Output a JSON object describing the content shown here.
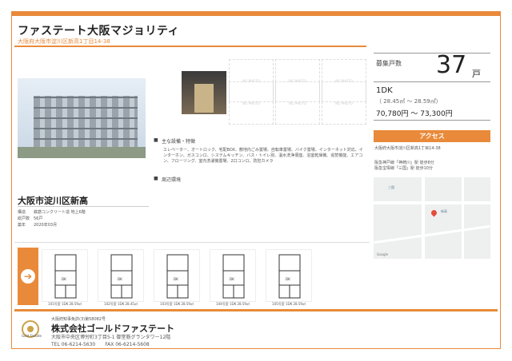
{
  "header": {
    "title": "ファステート大阪マジョリティ",
    "address": "大阪府大阪市淀川区新高1丁目14-38"
  },
  "photos": {
    "placeholder_label": "NO PHOTO"
  },
  "equipment": {
    "heading": "主な設備・特徴",
    "text": "エレベーター、オートロック、宅配BOX、敷地内ごみ置場、自転車置場、バイク置場、インターネット対応、インターホン、ガスコンロ、システムキッチン、バス・トイレ別、温水洗浄便座、浴室乾燥機、追焚機能、エアコン、フローリング、室内洗濯機置場、2口コンロ、防犯カメラ",
    "env_heading": "周辺環境"
  },
  "property": {
    "area_name": "大阪市淀川区新高",
    "rows": [
      {
        "k": "構造",
        "v": "鉄筋コンクリート造 地上6階"
      },
      {
        "k": "総戸数",
        "v": "56戸"
      },
      {
        "k": "築年",
        "v": "2020年03月"
      }
    ]
  },
  "recruit": {
    "label": "募集戸数",
    "count": "37",
    "unit": "戸",
    "layout": "1DK",
    "sqm": "（ 28.45㎡ ～ 28.59㎡）",
    "rent": "70,780円 ～ 73,300円"
  },
  "access": {
    "label": "アクセス",
    "address": "大阪府大阪市淀川区新高1丁目14-38",
    "line1": "阪急神戸線「神崎川」駅 徒歩8分",
    "line2": "阪急宝塚線「三国」駅 徒歩10分"
  },
  "map": {
    "labels": [
      "新高",
      "三国",
      "Google"
    ]
  },
  "floorplans": [
    {
      "caption": "101号室 1DK 28.59㎡",
      "label": "DK"
    },
    {
      "caption": "102号室 1DK 28.45㎡",
      "label": "DK"
    },
    {
      "caption": "103号室 1DK 28.59㎡",
      "label": "DK"
    },
    {
      "caption": "104号室 1DK 28.59㎡",
      "label": "DK"
    },
    {
      "caption": "105号室 1DK 28.59㎡",
      "label": "DK"
    }
  ],
  "footer": {
    "logo_text": "Gold Fastate",
    "license": "大阪府知事免許(3)第58082号",
    "company": "株式会社ゴールドファステート",
    "address": "大阪市中央区博労町3丁目5-1 御堂筋グランタワー12階",
    "tel": "TEL 06-6214-5630　　FAX 06-6214-5608"
  },
  "colors": {
    "accent": "#e98a3a",
    "pin": "#e64a3b"
  }
}
